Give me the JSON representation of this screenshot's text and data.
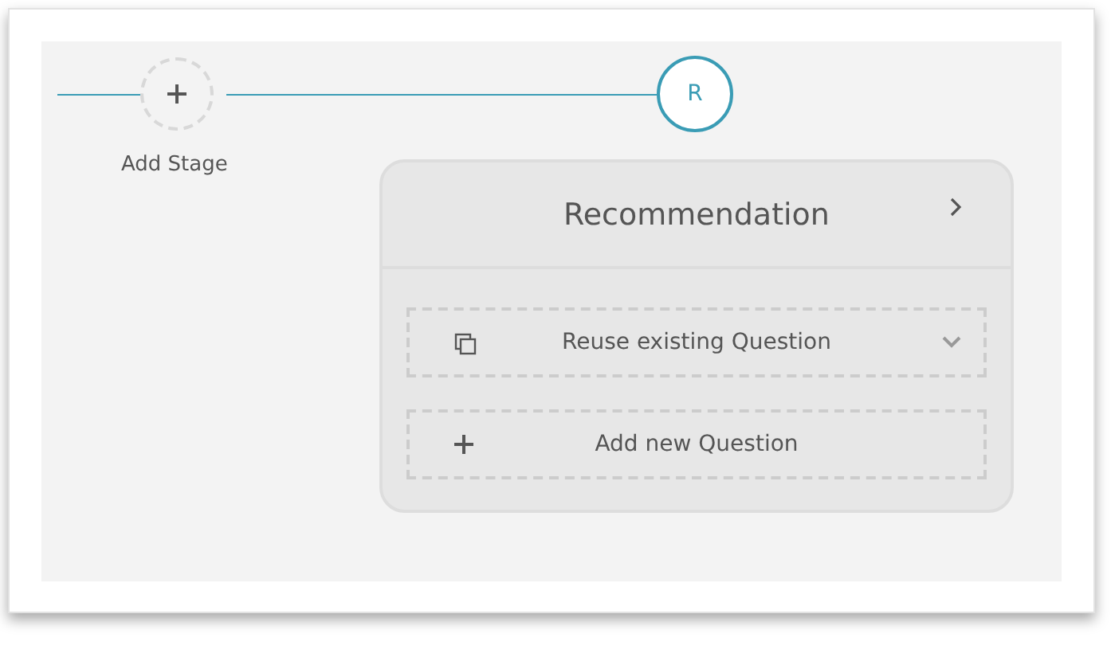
{
  "timeline": {
    "add_stage": {
      "label": "Add Stage"
    },
    "stages": [
      {
        "initial": "R",
        "selected": true
      }
    ]
  },
  "stage_card": {
    "title": "Recommendation",
    "actions": [
      {
        "kind": "reuse",
        "label": "Reuse existing Question"
      },
      {
        "kind": "add",
        "label": "Add new Question"
      }
    ]
  }
}
